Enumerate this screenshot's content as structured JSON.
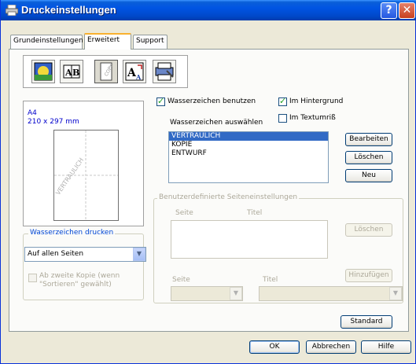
{
  "window": {
    "title": "Druckeinstellungen",
    "help_glyph": "?",
    "close_glyph": "✕"
  },
  "tabs": [
    {
      "label": "Grundeinstellungen",
      "active": false
    },
    {
      "label": "Erweitert",
      "active": true
    },
    {
      "label": "Support",
      "active": false
    }
  ],
  "toolbar": {
    "items": [
      {
        "name": "print-quality-icon"
      },
      {
        "name": "duplex-icon"
      },
      {
        "name": "watermark-icon",
        "selected": true
      },
      {
        "name": "scaling-icon"
      },
      {
        "name": "device-options-icon"
      }
    ]
  },
  "preview": {
    "paper_name": "A4",
    "paper_dims": "210 x 297 mm",
    "watermark_text": "VERTRAULICH"
  },
  "watermark_print": {
    "legend": "Wasserzeichen drucken",
    "selected": "Auf allen Seiten",
    "copy_checkbox_label_line1": "Ab zweite Kopie (wenn",
    "copy_checkbox_label_line2": "\"Sortieren\" gewählt)"
  },
  "watermark": {
    "use_label": "Wasserzeichen benutzen",
    "use_checked": true,
    "background_label": "Im Hintergrund",
    "background_checked": true,
    "outline_label": "Im Textumriß",
    "outline_checked": false,
    "select_label": "Wasserzeichen auswählen",
    "items": [
      "VERTRAULICH",
      "KOPIE",
      "ENTWURF"
    ],
    "selected_index": 0,
    "edit_button": "Bearbeiten",
    "delete_button": "Löschen",
    "new_button": "Neu"
  },
  "custom_pages": {
    "legend": "Benutzerdefinierte Seiteneinstellungen",
    "col_page": "Seite",
    "col_title": "Titel",
    "delete_button": "Löschen",
    "add_button": "Hinzufügen",
    "page_label": "Seite",
    "title_label": "Titel"
  },
  "footer": {
    "standard_button": "Standard",
    "ok_button": "OK",
    "cancel_button": "Abbrechen",
    "help_button": "Hilfe"
  },
  "colors": {
    "titlebar": "#0054e3",
    "selection": "#316ac5",
    "legend_text": "#0046d5",
    "dialog_bg": "#ece9d8"
  }
}
